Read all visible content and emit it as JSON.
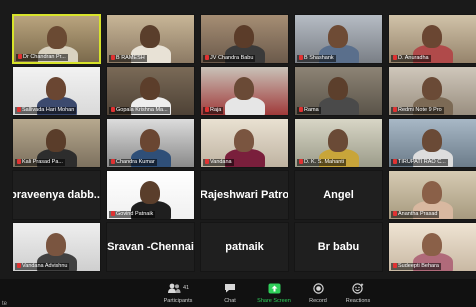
{
  "participants": [
    {
      "name": "Dr Chandran Pr...",
      "muted": true,
      "active": true
    },
    {
      "name": "B RAMESH",
      "muted": true
    },
    {
      "name": "JV Chandra Babu",
      "muted": true
    },
    {
      "name": "B Shashank",
      "muted": true
    },
    {
      "name": "D. Anuradha",
      "muted": true
    },
    {
      "name": "Sallivada Hari Mohan",
      "muted": true
    },
    {
      "name": "Gopala Krishna Ma...",
      "muted": true
    },
    {
      "name": "Raja",
      "muted": true
    },
    {
      "name": "Rama",
      "muted": true
    },
    {
      "name": "Redmi Note 9 Pro",
      "muted": true
    },
    {
      "name": "Kali Prasad Pa...",
      "muted": true
    },
    {
      "name": "Chandra Kumar",
      "muted": true
    },
    {
      "name": "Vandana",
      "muted": true
    },
    {
      "name": "D. K. S. Mahanti",
      "muted": true
    },
    {
      "name": "TIRUPATI RAO C...",
      "muted": true
    },
    {
      "name": "praveenya dabb...",
      "card": true
    },
    {
      "name": "Govind Patnaik",
      "muted": true
    },
    {
      "name": "Rajeshwari Patro",
      "card": true
    },
    {
      "name": "Angel",
      "card": true
    },
    {
      "name": "Anantha Prasad",
      "muted": true
    },
    {
      "name": "Vandana Advishnu",
      "muted": true
    },
    {
      "name": "Sravan -Chennai",
      "card": true
    },
    {
      "name": "patnaik",
      "card": true
    },
    {
      "name": "Br babu",
      "card": true
    },
    {
      "name": "Sudeepti Behara",
      "muted": true
    }
  ],
  "controls": {
    "participants_label": "Participants",
    "participants_count": "41",
    "chat_label": "Chat",
    "share_label": "Share Screen",
    "record_label": "Record",
    "reactions_label": "Reactions",
    "corner_text": "te"
  },
  "colors": {
    "active_border": "#d7e32a",
    "share_green": "#2fcf5a",
    "muted_red": "#e03232"
  }
}
